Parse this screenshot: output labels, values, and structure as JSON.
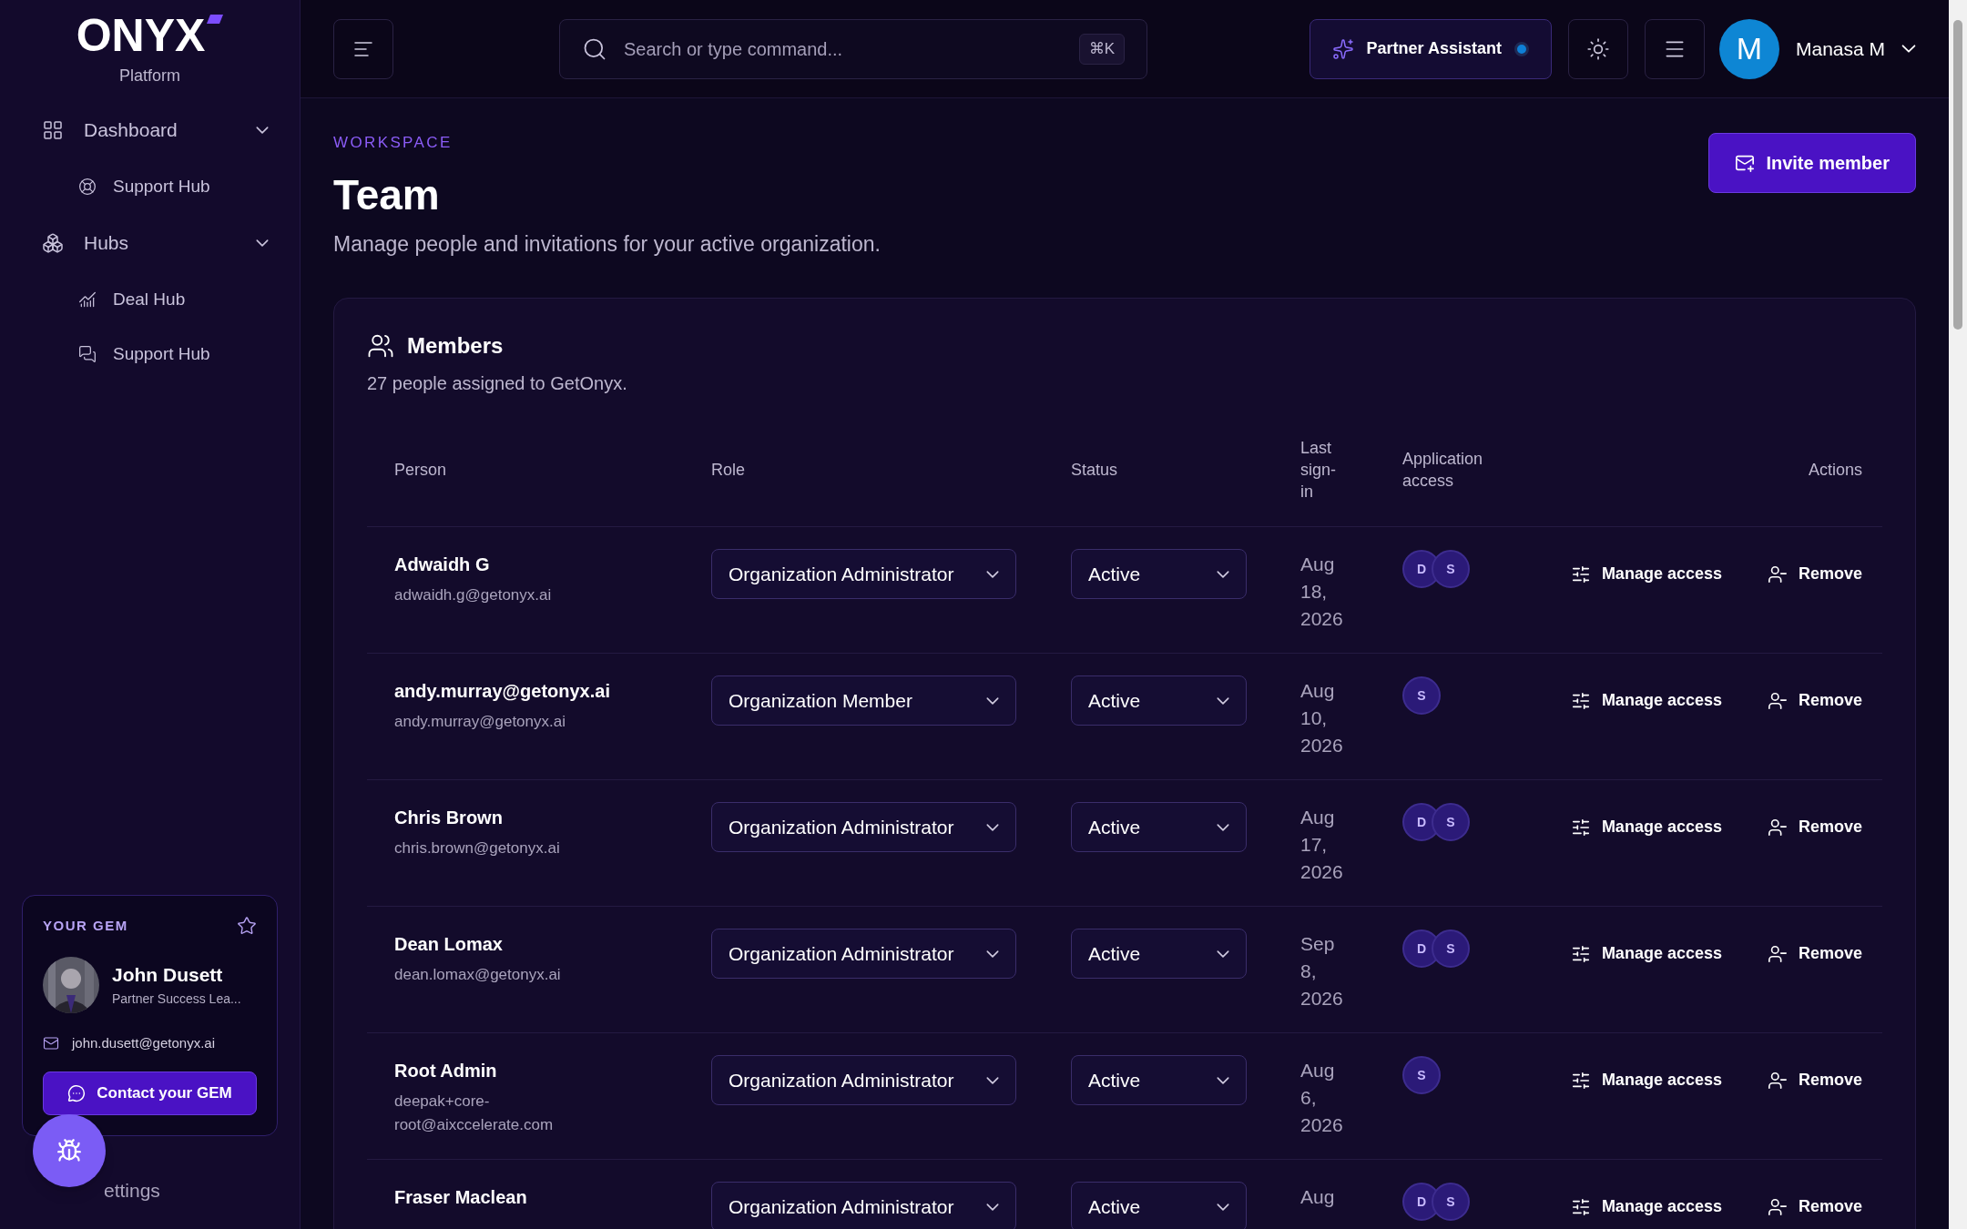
{
  "sidebar": {
    "logo": "ONYX",
    "subtitle": "Platform",
    "items": [
      {
        "label": "Dashboard",
        "kind": "group",
        "expanded": true,
        "children": [
          {
            "label": "Support Hub",
            "kind": "support"
          }
        ]
      },
      {
        "label": "Hubs",
        "kind": "hubs",
        "expanded": true,
        "children": [
          {
            "label": "Deal Hub",
            "kind": "deal"
          },
          {
            "label": "Support Hub",
            "kind": "chat"
          }
        ]
      }
    ],
    "gem": {
      "heading": "YOUR GEM",
      "name": "John Dusett",
      "role": "Partner Success Lea...",
      "email": "john.dusett@getonyx.ai",
      "button": "Contact your GEM"
    },
    "settings_label": "ettings"
  },
  "topbar": {
    "search_placeholder": "Search or type command...",
    "shortcut": "⌘K",
    "assistant": "Partner Assistant",
    "avatar_letter": "M",
    "user": "Manasa M"
  },
  "header": {
    "eyebrow": "WORKSPACE",
    "title": "Team",
    "subtitle": "Manage people and invitations for your active organization.",
    "invite_button": "Invite member"
  },
  "members": {
    "title": "Members",
    "summary": "27 people assigned to GetOnyx.",
    "columns": [
      "Person",
      "Role",
      "Status",
      "Last sign-in",
      "Application access",
      "Actions"
    ],
    "rows": [
      {
        "name": "Adwaidh G",
        "email": "adwaidh.g@getonyx.ai",
        "role": "Organization Administrator",
        "status": "Active",
        "last_sign_in": "Aug 18, 2026",
        "access": [
          "D",
          "S"
        ],
        "manage": "Manage access",
        "remove": "Remove"
      },
      {
        "name": "andy.murray@getonyx.ai",
        "email": "andy.murray@getonyx.ai",
        "role": "Organization Member",
        "status": "Active",
        "last_sign_in": "Aug 10, 2026",
        "access": [
          "S"
        ],
        "manage": "Manage access",
        "remove": "Remove"
      },
      {
        "name": "Chris Brown",
        "email": "chris.brown@getonyx.ai",
        "role": "Organization Administrator",
        "status": "Active",
        "last_sign_in": "Aug 17, 2026",
        "access": [
          "D",
          "S"
        ],
        "manage": "Manage access",
        "remove": "Remove"
      },
      {
        "name": "Dean Lomax",
        "email": "dean.lomax@getonyx.ai",
        "role": "Organization Administrator",
        "status": "Active",
        "last_sign_in": "Sep 8, 2026",
        "access": [
          "D",
          "S"
        ],
        "manage": "Manage access",
        "remove": "Remove"
      },
      {
        "name": "Root Admin",
        "email": "deepak+core-root@aixccelerate.com",
        "role": "Organization Administrator",
        "status": "Active",
        "last_sign_in": "Aug 6, 2026",
        "access": [
          "S"
        ],
        "manage": "Manage access",
        "remove": "Remove"
      },
      {
        "name": "Fraser Maclean",
        "role": "Organization Administrator",
        "status": "Active",
        "last_sign_in": "Aug",
        "access": [
          "D",
          "S"
        ],
        "manage": "Manage access",
        "remove": "Remove"
      }
    ]
  }
}
